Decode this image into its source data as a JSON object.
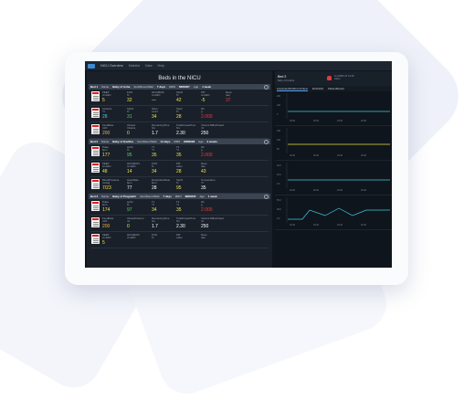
{
  "topbar": {
    "nav": [
      "NICU Overview",
      "Mainlist",
      "Data",
      "Help"
    ]
  },
  "left": {
    "title": "Beds in the NICU",
    "beds": [
      {
        "bed": "Bed 1",
        "name_label": "Name",
        "name": "Baby of Asha",
        "age_label": "Vent/Room/Wait",
        "age": "7 days",
        "mrn_label": "MRN",
        "mrn": "MRN007",
        "ga_label": "Age",
        "ga": "1 week",
        "rows": [
          [
            {
              "label": "PEEP\ncmH2O",
              "value": "5",
              "color": "#e8e24a"
            },
            {
              "label": "FiO2\n%",
              "value": "32",
              "color": "#e8e24a"
            },
            {
              "label": "HFO(MAP)\ncmH2O",
              "value": "—",
              "color": "#e8e24a"
            },
            {
              "label": "SpO2\n%",
              "value": "42",
              "color": "#e8e24a"
            },
            {
              "label": "PIP\ncmH2O",
              "value": "-5",
              "color": "#e8e24a"
            },
            {
              "label": "Resp\nrate",
              "value": "37",
              "color": "#ef3b3b"
            }
          ],
          [
            {
              "label": "Ambient\n°C",
              "value": "28",
              "color": "#40d0e0"
            },
            {
              "label": "SpO2\n%",
              "value": "31",
              "color": "#58d05a"
            },
            {
              "label": "Stool\ncount",
              "value": "34",
              "color": "#e8e24a"
            },
            {
              "label": "Spo2\n%",
              "value": "28",
              "color": "#e8e24a"
            },
            {
              "label": "Wt\ng",
              "value": "2.000",
              "color": "#ef3b3b"
            }
          ],
          [
            {
              "label": "FeedRate\nml/h",
              "value": "200",
              "color": "#e8b040"
            },
            {
              "label": "Infused\nVolume",
              "value": "0",
              "color": "#e8e24a"
            },
            {
              "label": "RemainingTime\nhrs",
              "value": "1.7",
              "color": "#ffffff"
            },
            {
              "label": "TotalInfusedTime\nhrs",
              "value": "2.30",
              "color": "#ffffff"
            },
            {
              "label": "VolumeToBeInfused\nml",
              "value": "250",
              "color": "#ffffff"
            }
          ]
        ]
      },
      {
        "bed": "Bed 2",
        "name_label": "Name",
        "name": "Baby of Kavitha",
        "age_label": "Vent/Room/Wait",
        "age": "14 days",
        "mrn_label": "MRN",
        "mrn": "MRN008",
        "ga_label": "Age",
        "ga": "2 weeks",
        "rows": [
          [
            {
              "label": "Pulse\nbpm",
              "value": "177",
              "color": "#e8e24a"
            },
            {
              "label": "spO2\n%",
              "value": "95",
              "color": "#58d05a"
            },
            {
              "label": "T1\n°C",
              "value": "35",
              "color": "#e8e24a"
            },
            {
              "label": "T2\n°C",
              "value": "35",
              "color": "#e8e24a"
            },
            {
              "label": "Wt\ng",
              "value": "2.000",
              "color": "#ef3b3b"
            }
          ],
          [
            {
              "label": "PEEP\ncmH2O",
              "value": "48",
              "color": "#e8e24a"
            },
            {
              "label": "HFO(MAP)\ncmH2O",
              "value": "14",
              "color": "#e8e24a"
            },
            {
              "label": "FiO2\n%",
              "value": "34",
              "color": "#e8e24a"
            },
            {
              "label": "PIP\nvalue",
              "value": "28",
              "color": "#e8e24a"
            },
            {
              "label": "Resp\nrate",
              "value": "43",
              "color": "#e8e24a"
            }
          ],
          [
            {
              "label": "BloodPressure\nmmHg",
              "value": "7/23",
              "color": "#e8e24a"
            },
            {
              "label": "HeartRate\nbpm",
              "value": "77",
              "color": "#ffffff"
            },
            {
              "label": "RespirationRate\nbpm",
              "value": "28",
              "color": "#ffffff"
            },
            {
              "label": "SpO2\n%",
              "value": "95",
              "color": "#e8e24a"
            },
            {
              "label": "Temperature\n°C",
              "value": "35",
              "color": "#ffffff"
            }
          ]
        ]
      },
      {
        "bed": "Bed 3",
        "name_label": "Name",
        "name": "Baby of Pragnathi",
        "age_label": "Vent/Room/Wait",
        "age": "7 days",
        "mrn_label": "MRN",
        "mrn": "MRN005",
        "ga_label": "Age",
        "ga": "1 week",
        "rows": [
          [
            {
              "label": "Pulse\nbpm",
              "value": "174",
              "color": "#e8e24a"
            },
            {
              "label": "spO2\n%",
              "value": "97",
              "color": "#58d05a"
            },
            {
              "label": "T1\n°C",
              "value": "34",
              "color": "#e8e24a"
            },
            {
              "label": "T2\n°C",
              "value": "35",
              "color": "#e8e24a"
            },
            {
              "label": "Wt\ng",
              "value": "2.000",
              "color": "#ef3b3b"
            }
          ],
          [
            {
              "label": "FeedRate\nml/h",
              "value": "200",
              "color": "#e8b040"
            },
            {
              "label": "InfusedVolume\nml",
              "value": "0",
              "color": "#e8e24a"
            },
            {
              "label": "RemainingTime\nhrs",
              "value": "1.7",
              "color": "#ffffff"
            },
            {
              "label": "TotalInfusedTime\nhrs",
              "value": "2.30",
              "color": "#ffffff"
            },
            {
              "label": "VolumeToBeInfused\nml",
              "value": "250",
              "color": "#ffffff"
            }
          ],
          [
            {
              "label": "PEEP\ncmH2O",
              "value": "5",
              "color": "#e8e24a"
            },
            {
              "label": "HFO(MAP)\ncmH2O",
              "value": "",
              "color": "#e8e24a"
            },
            {
              "label": "FiO2\n%",
              "value": "",
              "color": "#e8e24a"
            },
            {
              "label": "PIP\nvalue",
              "value": "",
              "color": "#e8e24a"
            },
            {
              "label": "Resp\nrate",
              "value": "",
              "color": "#e8e24a"
            }
          ]
        ]
      }
    ]
  },
  "right": {
    "title": "Bed 2",
    "subtitle": "Baby of Kavitha",
    "alarm": "11 ARMS AT 16:46\nAlarm",
    "tabs": [
      "Ampitude/WindFromCollect",
      "ECGSSO",
      "PatientMonitor"
    ],
    "plots": [
      {
        "name": "hr",
        "color": "#40c8e0",
        "ticks": [
          "200",
          "100",
          "0"
        ],
        "xticks": [
          "18:40",
          "18:40",
          "18:40",
          "18:40"
        ]
      },
      {
        "name": "spo2",
        "color": "#e8e24a",
        "ticks": [
          "150",
          "100",
          "50"
        ],
        "xticks": [
          "18:40",
          "18:40",
          "18:40",
          "18:40"
        ]
      },
      {
        "name": "resp",
        "color": "#40c8e0",
        "ticks": [
          "32.0",
          "16.0",
          "0.0"
        ],
        "xticks": [
          "18:40",
          "18:40",
          "18:40",
          "18:40"
        ]
      },
      {
        "name": "temp",
        "color": "#40c8e0",
        "ticks": [
          "55.0",
          "38.0",
          "0.0"
        ],
        "xticks": [
          "18:40",
          "18:40",
          "18:40",
          "18:40"
        ]
      }
    ]
  }
}
